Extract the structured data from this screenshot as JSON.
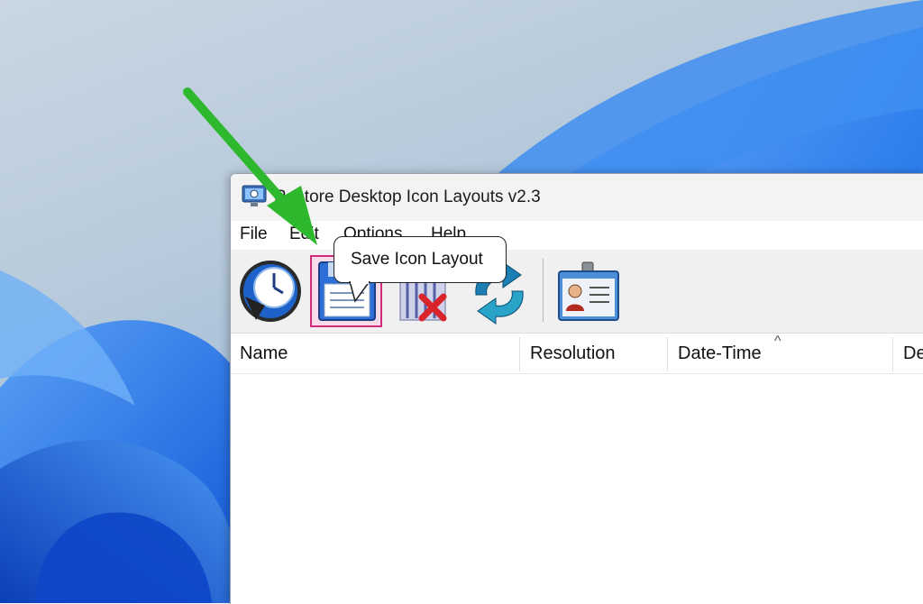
{
  "window": {
    "title": "Restore Desktop Icon Layouts v2.3"
  },
  "menu": {
    "items": [
      {
        "label": "File"
      },
      {
        "label": "Edit"
      },
      {
        "label": "Options"
      },
      {
        "label": "Help"
      }
    ]
  },
  "toolbar": {
    "buttons": [
      {
        "icon": "restore-clock-icon",
        "tooltip": ""
      },
      {
        "icon": "floppy-save-icon",
        "tooltip": "Save Icon Layout"
      },
      {
        "icon": "delete-layout-icon",
        "tooltip": ""
      },
      {
        "icon": "refresh-icon",
        "tooltip": ""
      },
      {
        "icon": "id-card-icon",
        "tooltip": ""
      }
    ]
  },
  "tooltip": {
    "text": "Save Icon Layout"
  },
  "table": {
    "columns": [
      {
        "label": "Name"
      },
      {
        "label": "Resolution"
      },
      {
        "label": "Date-Time"
      },
      {
        "label": "De"
      }
    ],
    "rows": []
  },
  "colors": {
    "highlight_border": "#d12b7a",
    "arrow": "#2db82d",
    "wallpaper_blue": "#1a6fe8"
  }
}
